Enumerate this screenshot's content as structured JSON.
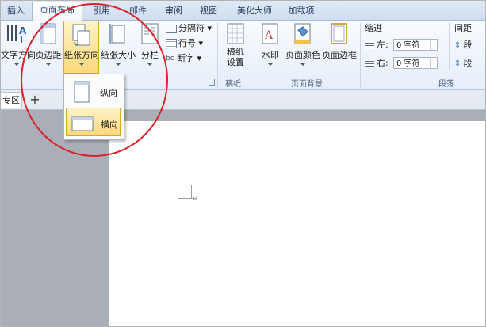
{
  "tabs": [
    {
      "label": "插入"
    },
    {
      "label": "页面布局"
    },
    {
      "label": "引用"
    },
    {
      "label": "邮件"
    },
    {
      "label": "审阅"
    },
    {
      "label": "视图"
    },
    {
      "label": "美化大师"
    },
    {
      "label": "加载项"
    }
  ],
  "ribbon": {
    "text_direction": "文字方向",
    "margins": "页边距",
    "orientation": "纸张方向",
    "size": "纸张大小",
    "columns": "分栏",
    "breaks": "分隔符",
    "line_numbers": "行号",
    "hyphenation": "断字",
    "manuscript": "稿纸\n设置",
    "manuscript_l1": "稿纸",
    "manuscript_l2": "设置",
    "manuscript_group": "稿纸",
    "watermark": "水印",
    "page_color": "页面颜色",
    "page_borders": "页面边框",
    "page_background_group": "页面背景",
    "indent_title": "缩进",
    "indent_left_label": "左:",
    "indent_left_value": "0 字符",
    "indent_right_label": "右:",
    "indent_right_value": "0 字符",
    "spacing_title": "间距",
    "spacing_before": "段",
    "spacing_after": "段",
    "paragraph_group": "段落"
  },
  "doc_tabs": {
    "partial_tab": "专区",
    "new_tab": "+"
  },
  "orientation_menu": {
    "portrait": "纵向",
    "landscape": "横向"
  },
  "document": {
    "paragraph_mark": "↵"
  },
  "colors": {
    "accent_highlight": "#fbd97a",
    "annotation_circle": "#d9222a",
    "tab_text": "#233a5e"
  }
}
